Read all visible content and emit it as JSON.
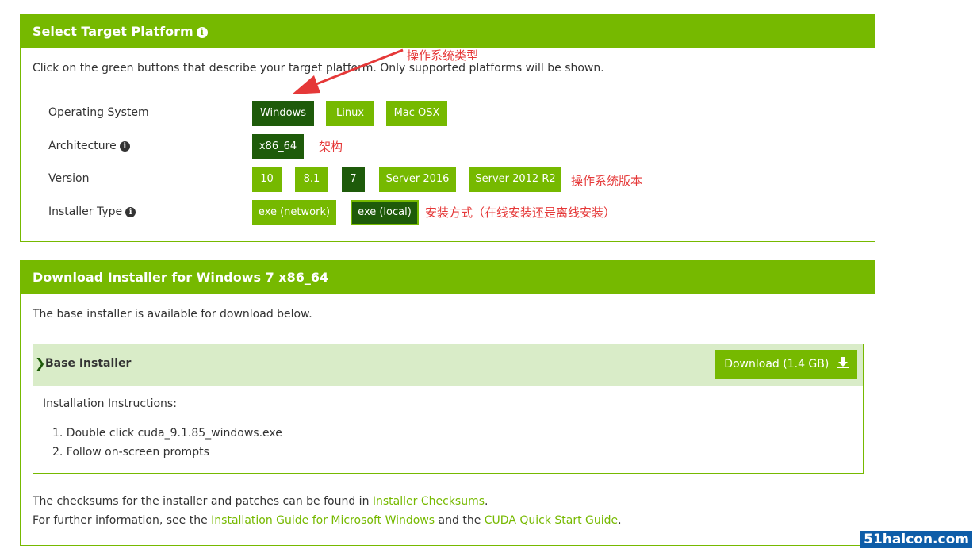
{
  "platform_panel": {
    "title": "Select Target Platform",
    "intro": "Click on the green buttons that describe your target platform. Only supported platforms will be shown.",
    "rows": {
      "os": {
        "label": "Operating System",
        "options": [
          "Windows",
          "Linux",
          "Mac OSX"
        ],
        "selected": "Windows"
      },
      "arch": {
        "label": "Architecture",
        "options": [
          "x86_64"
        ],
        "selected": "x86_64"
      },
      "version": {
        "label": "Version",
        "options": [
          "10",
          "8.1",
          "7",
          "Server 2016",
          "Server 2012 R2"
        ],
        "selected": "7"
      },
      "installer": {
        "label": "Installer Type",
        "options": [
          "exe (network)",
          "exe (local)"
        ],
        "selected": "exe (local)"
      }
    }
  },
  "annotations": {
    "os_type": "操作系统类型",
    "arch": "架构",
    "os_version": "操作系统版本",
    "install_method": "安装方式（在线安装还是离线安装）"
  },
  "download_panel": {
    "title": "Download Installer for Windows 7 x86_64",
    "intro": "The base installer is available for download below.",
    "base_installer": {
      "title": "Base Installer",
      "download_label": "Download (1.4 GB)",
      "instructions_title": "Installation Instructions:",
      "steps": [
        "1. Double click cuda_9.1.85_windows.exe",
        "2. Follow on-screen prompts"
      ]
    },
    "checksums": {
      "prefix": "The checksums for the installer and patches can be found in ",
      "link": "Installer Checksums",
      "suffix": "."
    },
    "further": {
      "prefix": "For further information, see the ",
      "link1": "Installation Guide for Microsoft Windows",
      "middle": " and the ",
      "link2": "CUDA Quick Start Guide",
      "suffix": "."
    }
  },
  "watermark": "51halcon.com",
  "colors": {
    "accent": "#76b900",
    "selected": "#1e5b0a",
    "annotation": "#e53838"
  }
}
